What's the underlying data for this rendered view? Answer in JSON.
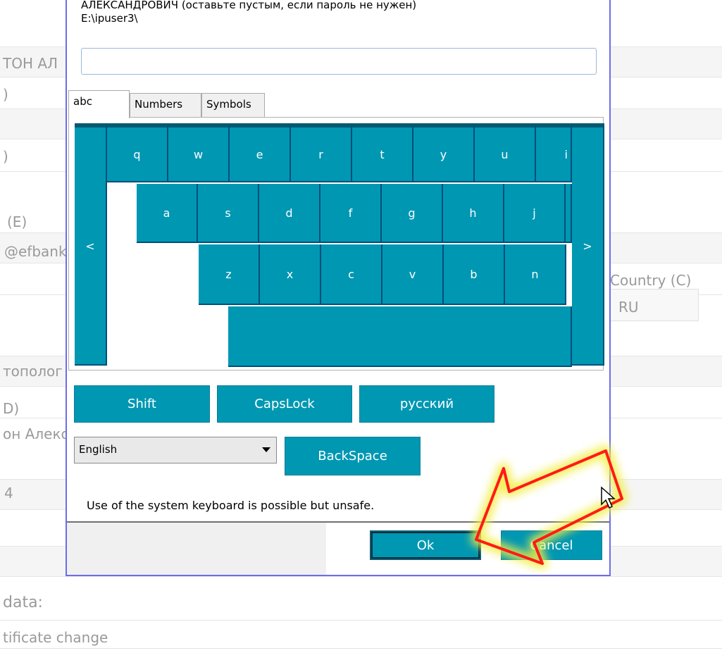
{
  "background": {
    "frag_0": "ТОН АЛ",
    "frag_1": ")",
    "frag_2": ")",
    "frag_3": "(E)",
    "frag_4": "@efbank",
    "frag_5": "тополог",
    "frag_6": "D)",
    "frag_7": "он Алекс",
    "frag_8": "4",
    "country_label": "Country (C)",
    "country_value": "RU",
    "data_label": "data:",
    "cert_change": "tificate change"
  },
  "dialog": {
    "prompt_line1": "АЛЕКСАНДРОВИЧ (оставьте пустым, если пароль не нужен)",
    "prompt_line2": "E:\\ipuser3\\",
    "password_value": "",
    "tabs": [
      {
        "label": "abc",
        "active": true
      },
      {
        "label": "Numbers",
        "active": false
      },
      {
        "label": "Symbols",
        "active": false
      }
    ],
    "keyboard": {
      "row1": [
        "q",
        "w",
        "e",
        "r",
        "t",
        "y",
        "u",
        "i"
      ],
      "row2": [
        "a",
        "s",
        "d",
        "f",
        "g",
        "h",
        "j"
      ],
      "row3": [
        "z",
        "x",
        "c",
        "v",
        "b",
        "n"
      ],
      "left_arrow": "<",
      "right_arrow": ">",
      "space": ""
    },
    "buttons": {
      "shift": "Shift",
      "capslock": "CapsLock",
      "russian": "русский",
      "backspace": "BackSpace",
      "ok": "Ok",
      "cancel": "Cancel"
    },
    "language": {
      "selected": "English"
    },
    "warning": "Use of the system keyboard is possible but unsafe."
  },
  "colors": {
    "key": "#0097b2",
    "key_border": "#004f7a",
    "dialog_border": "#6d6de8",
    "annotation_arrow": "#ff1a1a"
  }
}
